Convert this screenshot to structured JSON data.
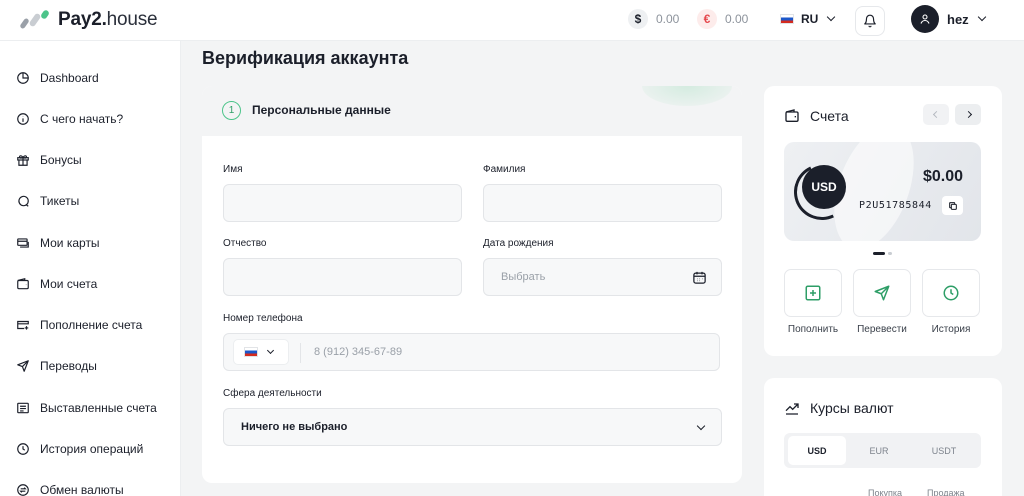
{
  "brand": {
    "bold": "Pay2.",
    "regular": "house"
  },
  "header": {
    "balance_usd": {
      "symbol": "$",
      "amount": "0.00"
    },
    "balance_eur": {
      "symbol": "€",
      "amount": "0.00"
    },
    "language": "RU",
    "user_name": "hez"
  },
  "sidebar": {
    "items": [
      {
        "label": "Dashboard",
        "icon": "pie-chart-icon"
      },
      {
        "label": "С чего начать?",
        "icon": "info-icon"
      },
      {
        "label": "Бонусы",
        "icon": "gift-icon"
      },
      {
        "label": "Тикеты",
        "icon": "chat-icon"
      },
      {
        "label": "Мои карты",
        "icon": "cards-icon"
      },
      {
        "label": "Мои счета",
        "icon": "wallet-icon"
      },
      {
        "label": "Пополнение счета",
        "icon": "card-plus-icon"
      },
      {
        "label": "Переводы",
        "icon": "send-icon"
      },
      {
        "label": "Выставленные счета",
        "icon": "invoice-icon"
      },
      {
        "label": "История операций",
        "icon": "clock-icon"
      },
      {
        "label": "Обмен валюты",
        "icon": "exchange-icon"
      }
    ]
  },
  "page": {
    "title": "Верификация аккаунта"
  },
  "form": {
    "step_number": "1",
    "step_title": "Персональные данные",
    "first_name_label": "Имя",
    "last_name_label": "Фамилия",
    "middle_name_label": "Отчество",
    "birth_date_label": "Дата рождения",
    "birth_date_placeholder": "Выбрать",
    "phone_label": "Номер телефона",
    "phone_placeholder": "8 (912) 345-67-89",
    "activity_label": "Сфера деятельности",
    "activity_value": "Ничего не выбрано"
  },
  "accounts": {
    "title": "Счета",
    "card": {
      "currency": "USD",
      "amount": "$0.00",
      "number": "P2U51785844"
    },
    "actions": [
      {
        "label": "Пополнить",
        "icon": "plus-square-icon"
      },
      {
        "label": "Перевести",
        "icon": "send-icon"
      },
      {
        "label": "История",
        "icon": "clock-icon"
      }
    ]
  },
  "rates": {
    "title": "Курсы валют",
    "tabs": [
      "USD",
      "EUR",
      "USDT"
    ],
    "active_tab": "USD",
    "columns": [
      "Покупка",
      "Продажа"
    ]
  },
  "colors": {
    "accent_green": "#4cc48a",
    "dark": "#1b1f2a",
    "euro_red": "#e5484d"
  }
}
